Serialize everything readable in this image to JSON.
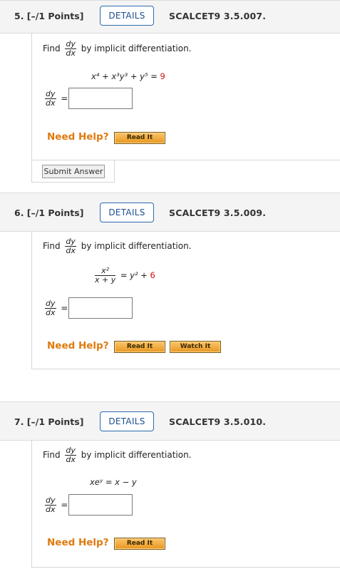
{
  "q5": {
    "points": "5. [–/1 Points]",
    "details": "DETAILS",
    "code": "SCALCET9 3.5.007.",
    "find": "Find",
    "dy": "dy",
    "dx": "dx",
    "by": "by implicit differentiation.",
    "equation_lhs": "x⁴ + x³y³ + y⁵ = ",
    "equation_rhs": "9",
    "need_help": "Need Help?",
    "read_it": "Read It",
    "submit": "Submit Answer"
  },
  "q6": {
    "points": "6. [–/1 Points]",
    "details": "DETAILS",
    "code": "SCALCET9 3.5.009.",
    "find": "Find",
    "dy": "dy",
    "dx": "dx",
    "by": "by implicit differentiation.",
    "frac_num": "x²",
    "frac_den": "x + y",
    "equation_mid": "= y² + ",
    "equation_rhs": "6",
    "need_help": "Need Help?",
    "read_it": "Read It",
    "watch_it": "Watch It"
  },
  "q7": {
    "points": "7. [–/1 Points]",
    "details": "DETAILS",
    "code": "SCALCET9 3.5.010.",
    "find": "Find",
    "dy": "dy",
    "dx": "dx",
    "by": "by implicit differentiation.",
    "equation": "xeʸ = x − y",
    "need_help": "Need Help?",
    "read_it": "Read It"
  },
  "equals": "="
}
